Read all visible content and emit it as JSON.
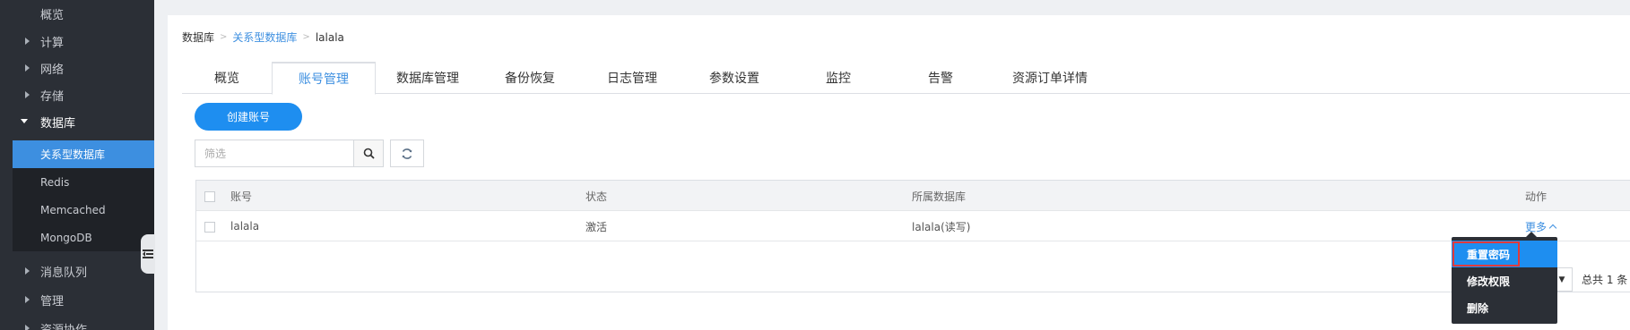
{
  "sidebar": {
    "items": [
      {
        "label": "概览"
      },
      {
        "label": "计算"
      },
      {
        "label": "网络"
      },
      {
        "label": "存储"
      },
      {
        "label": "数据库"
      },
      {
        "label": "消息队列"
      },
      {
        "label": "管理"
      },
      {
        "label": "资源协作"
      }
    ],
    "database_sub": [
      {
        "label": "关系型数据库"
      },
      {
        "label": "Redis"
      },
      {
        "label": "Memcached"
      },
      {
        "label": "MongoDB"
      }
    ]
  },
  "breadcrumb": {
    "root": "数据库",
    "parent": "关系型数据库",
    "current": "lalala"
  },
  "tabs": [
    {
      "label": "概览"
    },
    {
      "label": "账号管理"
    },
    {
      "label": "数据库管理"
    },
    {
      "label": "备份恢复"
    },
    {
      "label": "日志管理"
    },
    {
      "label": "参数设置"
    },
    {
      "label": "监控"
    },
    {
      "label": "告警"
    },
    {
      "label": "资源订单详情"
    }
  ],
  "toolbar": {
    "create_label": "创建账号",
    "filter_placeholder": "筛选"
  },
  "table": {
    "headers": {
      "account": "账号",
      "status": "状态",
      "database": "所属数据库",
      "action": "动作"
    },
    "rows": [
      {
        "account": "lalala",
        "status": "激活",
        "database": "lalala(读写)",
        "action": "更多"
      }
    ]
  },
  "pagination": {
    "total": "总共 1 条"
  },
  "dropdown": {
    "items": [
      {
        "label": "重置密码"
      },
      {
        "label": "修改权限"
      },
      {
        "label": "删除"
      }
    ]
  },
  "colors": {
    "accent": "#1e8ef0",
    "sidebar_bg": "#2b2f36",
    "sidebar_selected": "#3d8fe0",
    "highlight_box": "#e23a3a"
  }
}
